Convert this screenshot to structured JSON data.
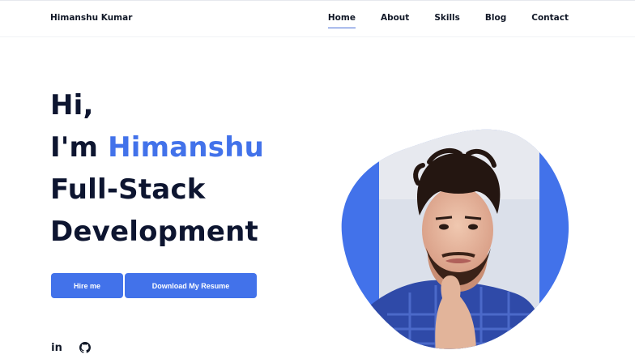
{
  "nav": {
    "brand": "Himanshu Kumar",
    "links": [
      "Home",
      "About",
      "Skills",
      "Blog",
      "Contact"
    ],
    "active": "Home"
  },
  "hero": {
    "line1": "Hi,",
    "line2_prefix": "I'm ",
    "name": "Himanshu",
    "line3": "Full-Stack",
    "line4": "Development"
  },
  "buttons": {
    "hire": "Hire me",
    "resume": "Download My Resume"
  },
  "social": {
    "linkedin_icon": "linkedin-icon",
    "github_icon": "github-icon"
  },
  "colors": {
    "accent": "#4272ea",
    "text": "#0d1530"
  }
}
